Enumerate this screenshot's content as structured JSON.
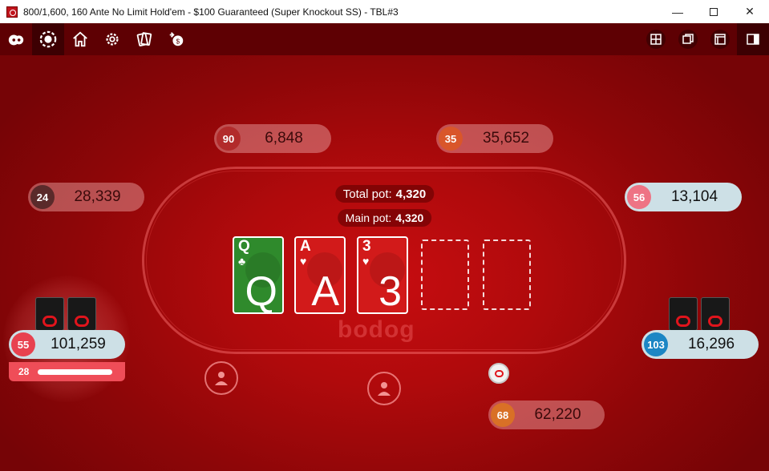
{
  "window": {
    "title": "800/1,600, 160 Ante No Limit Hold'em - $100 Guaranteed (Super Knockout SS) - TBL#3",
    "min": "—",
    "close": "✕"
  },
  "toolbar": {
    "left_icons": [
      "lobby-icon",
      "poker-chip-icon",
      "home-icon",
      "settings-icon",
      "cards-icon",
      "rebuy-icon"
    ],
    "right_icons": [
      "tile-icon",
      "cascade-icon",
      "window-icon",
      "sidebar-icon"
    ]
  },
  "pot": {
    "total_label": "Total pot:",
    "total_value": "4,320",
    "main_label": "Main pot:",
    "main_value": "4,320"
  },
  "board": [
    {
      "rank": "Q",
      "suit": "♣",
      "color": "#2f8a2c"
    },
    {
      "rank": "A",
      "suit": "♥",
      "color": "#d21a1a"
    },
    {
      "rank": "3",
      "suit": "♥",
      "color": "#d21a1a"
    }
  ],
  "watermark": "bodog",
  "seats": [
    {
      "level": "90",
      "stack": "6,848",
      "level_color": "#b22b2b"
    },
    {
      "level": "35",
      "stack": "35,652",
      "level_color": "#d9562a"
    },
    {
      "level": "24",
      "stack": "28,339",
      "level_color": "#5a2a2a"
    },
    {
      "level": "56",
      "stack": "13,104",
      "level_color": "#ee7384"
    },
    {
      "level": "55",
      "stack": "101,259",
      "level_color": "#e8424f"
    },
    {
      "level": "103",
      "stack": "16,296",
      "level_color": "#1c86c4"
    },
    {
      "level": "68",
      "stack": "62,220",
      "level_color": "#d97026"
    }
  ],
  "hero_timer": {
    "seconds": "28",
    "remaining_fraction": 0.93
  }
}
